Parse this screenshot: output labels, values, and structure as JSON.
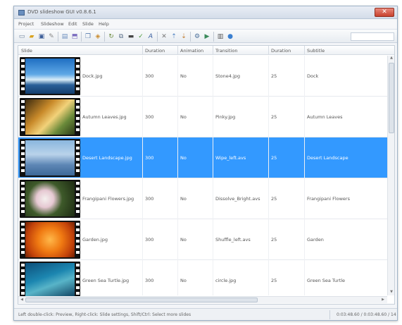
{
  "window": {
    "title": "DVD slideshow GUI v0.8.6.1",
    "close_label": "✕"
  },
  "menu": [
    "Project",
    "Slideshow",
    "Edit",
    "Slide",
    "Help"
  ],
  "toolbar": {
    "icons": [
      "new-icon",
      "open-icon",
      "save-icon",
      "edit-icon",
      "add-image-icon",
      "add-text-icon",
      "copy-icon",
      "paste-icon",
      "rotate-icon",
      "crop-icon",
      "delete-icon",
      "check-icon",
      "font-icon",
      "cut-icon",
      "move-up-icon",
      "move-down-icon",
      "settings-icon",
      "preview-icon",
      "film-icon",
      "info-icon"
    ]
  },
  "columns": [
    "Slide",
    "Duration",
    "Animation",
    "Transition",
    "Duration",
    "Subtitle"
  ],
  "rows": [
    {
      "file": "Dock.jpg",
      "duration": "300",
      "animation": "No",
      "transition": "Stone4.jpg",
      "tduration": "25",
      "subtitle": "Dock",
      "selected": false,
      "gradient": "linear-gradient(#1f6fc2 0%, #5fa8e6 45%, #d8ecf8 60%, #2a5f98 75%, #143e6e 100%)"
    },
    {
      "file": "Autumn Leaves.jpg",
      "duration": "300",
      "animation": "No",
      "transition": "Pinky.jpg",
      "tduration": "25",
      "subtitle": "Autumn Leaves",
      "selected": false,
      "gradient": "linear-gradient(135deg, #3c2a0f 0%, #c98a2a 35%, #f2d27a 55%, #6a8a3a 75%, #2c3a16 100%)"
    },
    {
      "file": "Desert Landscape.jpg",
      "duration": "300",
      "animation": "No",
      "transition": "Wipe_left.avs",
      "tduration": "25",
      "subtitle": "Desert Landscape",
      "selected": true,
      "gradient": "linear-gradient(#8ab6de 0%, #b9d3ea 40%, #5d86b5 70%, #3d6897 100%)"
    },
    {
      "file": "Frangipani Flowers.jpg",
      "duration": "300",
      "animation": "No",
      "transition": "Dissolve_Bright.avs",
      "tduration": "25",
      "subtitle": "Frangipani Flowers",
      "selected": false,
      "gradient": "radial-gradient(circle at 40% 50%, #f4f0ee 0%, #e6c8d2 25%, #3e5a2a 50%, #1d2a12 100%)"
    },
    {
      "file": "Garden.jpg",
      "duration": "300",
      "animation": "No",
      "transition": "Shuffle_left.avs",
      "tduration": "25",
      "subtitle": "Garden",
      "selected": false,
      "gradient": "radial-gradient(circle at 50% 50%, #ffb84a 0%, #f07a12 40%, #c2420a 75%, #6e1f04 100%)"
    },
    {
      "file": "Green Sea Turtle.jpg",
      "duration": "300",
      "animation": "No",
      "transition": "circle.jpg",
      "tduration": "25",
      "subtitle": "Green Sea Turtle",
      "selected": false,
      "gradient": "linear-gradient(160deg, #0d4f7a 0%, #1c86b0 40%, #58b4c8 60%, #0a3a5a 100%)"
    }
  ],
  "status": {
    "hint": "Left double-click: Preview, Right-click: Slide settings, Shift/Ctrl: Select more slides",
    "total_time": "0:03:48.60 / 0:03:48.60 / 14"
  }
}
